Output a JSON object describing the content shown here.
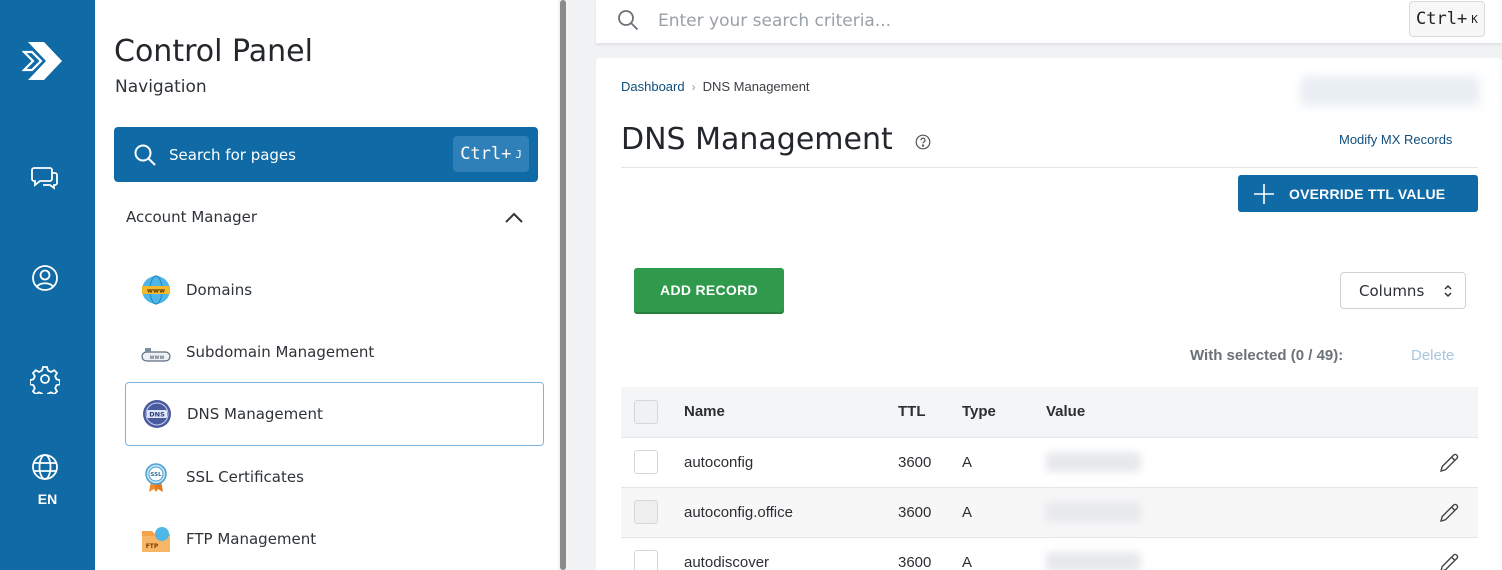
{
  "rail": {
    "items": [
      "logo-icon",
      "chat-icon",
      "user-icon",
      "gear-icon",
      "globe-icon"
    ],
    "language": "EN"
  },
  "nav": {
    "title": "Control Panel",
    "subtitle": "Navigation",
    "search": {
      "label": "Search for pages",
      "shortcut_main": "Ctrl+",
      "shortcut_key": "J"
    },
    "section": "Account Manager",
    "items": [
      {
        "label": "Domains",
        "icon": "www-globe-icon"
      },
      {
        "label": "Subdomain Management",
        "icon": "subdomain-icon"
      },
      {
        "label": "DNS Management",
        "icon": "dns-icon",
        "active": true
      },
      {
        "label": "SSL Certificates",
        "icon": "ssl-badge-icon"
      },
      {
        "label": "FTP Management",
        "icon": "ftp-folder-icon"
      }
    ]
  },
  "topbar": {
    "placeholder": "Enter your search criteria...",
    "shortcut_main": "Ctrl+",
    "shortcut_key": "K"
  },
  "main": {
    "breadcrumb": {
      "home": "Dashboard",
      "current": "DNS Management"
    },
    "title": "DNS Management",
    "mx_link": "Modify MX Records",
    "override_label": "OVERRIDE TTL VALUE",
    "add_record_label": "ADD RECORD",
    "columns_label": "Columns",
    "with_selected": "With selected (0 / 49):",
    "delete_label": "Delete",
    "table": {
      "headers": {
        "name": "Name",
        "ttl": "TTL",
        "type": "Type",
        "value": "Value"
      },
      "rows": [
        {
          "name": "autoconfig",
          "ttl": "3600",
          "type": "A"
        },
        {
          "name": "autoconfig.office",
          "ttl": "3600",
          "type": "A"
        },
        {
          "name": "autodiscover",
          "ttl": "3600",
          "type": "A"
        }
      ]
    }
  },
  "colors": {
    "primary": "#0f6aa6",
    "success": "#2f9a4c",
    "link": "#0f4f7e"
  }
}
